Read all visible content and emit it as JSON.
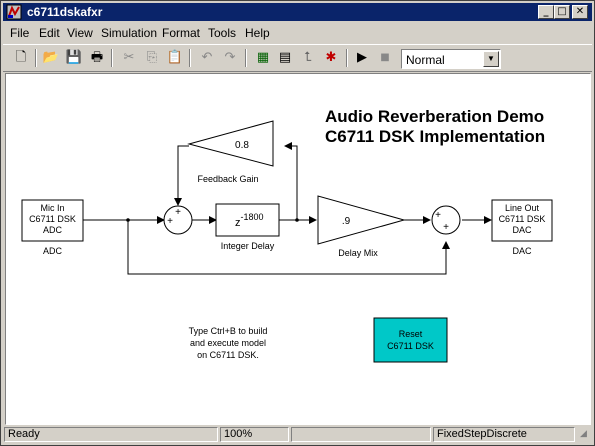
{
  "window": {
    "title": "c6711dskafxr"
  },
  "menu": [
    "File",
    "Edit",
    "View",
    "Simulation",
    "Format",
    "Tools",
    "Help"
  ],
  "toolbar": {
    "mode": "Normal"
  },
  "diagram": {
    "title1": "Audio Reverberation Demo",
    "title2": "C6711 DSK Implementation",
    "adc_block": [
      "Mic In",
      "C6711 DSK",
      "ADC"
    ],
    "adc_label": "ADC",
    "feedback_value": "0.8",
    "feedback_label": "Feedback Gain",
    "delay_base": "z",
    "delay_exp": "-1800",
    "delay_label": "Integer Delay",
    "mix_value": ".9",
    "mix_label": "Delay Mix",
    "dac_block": [
      "Line Out",
      "C6711 DSK",
      "DAC"
    ],
    "dac_label": "DAC",
    "note": [
      "Type Ctrl+B to build",
      "and execute model",
      "on C6711 DSK."
    ],
    "reset_block": [
      "Reset",
      "C6711 DSK"
    ],
    "reset_color": "#00c8c8"
  },
  "status": {
    "ready": "Ready",
    "zoom": "100%",
    "solver": "FixedStepDiscrete"
  }
}
